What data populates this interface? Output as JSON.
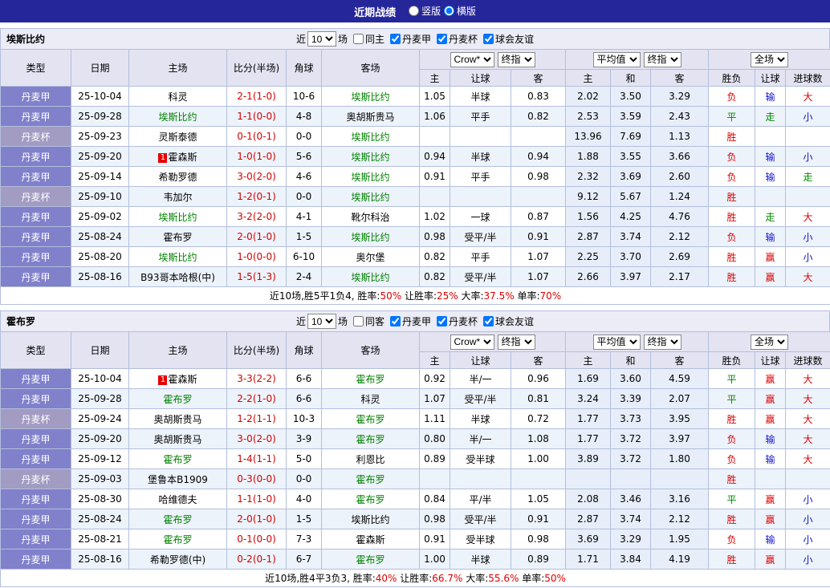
{
  "topbar": {
    "title": "近期战绩",
    "layout_options": [
      {
        "label": "竖版",
        "selected": false
      },
      {
        "label": "横版",
        "selected": true
      }
    ]
  },
  "palette": {
    "topbar_bg": "#26269b",
    "league_bg": "#8080cb",
    "cup_bg": "#a29bc2",
    "score": "#d40000",
    "team_green": "#008000",
    "red": "#dd0000",
    "green": "#008800",
    "blue": "#1111cc"
  },
  "table_head": {
    "cols": [
      "类型",
      "日期",
      "主场",
      "比分(半场)",
      "角球",
      "客场"
    ],
    "sub": [
      "主",
      "让球",
      "客",
      "主",
      "和",
      "客",
      "胜负",
      "让球",
      "进球数"
    ],
    "selects": {
      "company": "Crow*",
      "company_stage": "终指",
      "average": "平均值",
      "average_stage": "终指",
      "scope": "全场"
    }
  },
  "sections": [
    {
      "team": "埃斯比约",
      "filter": {
        "prefix": "近",
        "count": "10",
        "suffix": "场",
        "same": {
          "label": "同主",
          "checked": false
        },
        "comps": [
          {
            "label": "丹麦甲",
            "checked": true
          },
          {
            "label": "丹麦杯",
            "checked": true
          },
          {
            "label": "球会友谊",
            "checked": true
          }
        ]
      },
      "rows": [
        {
          "type": "丹麦甲",
          "cup": false,
          "date": "25-10-04",
          "home": {
            "name": "科灵",
            "green": false,
            "badge": ""
          },
          "score": "2-1(1-0)",
          "corner": "10-6",
          "away": {
            "name": "埃斯比约",
            "green": true,
            "badge": ""
          },
          "odds": [
            "1.05",
            "半球",
            "0.83"
          ],
          "avg": [
            "2.02",
            "3.50",
            "3.29"
          ],
          "res": [
            [
              "负",
              "red"
            ],
            [
              "输",
              "blue"
            ],
            [
              "大",
              "red"
            ]
          ]
        },
        {
          "type": "丹麦甲",
          "cup": false,
          "date": "25-09-28",
          "home": {
            "name": "埃斯比约",
            "green": true,
            "badge": ""
          },
          "score": "1-1(0-0)",
          "corner": "4-8",
          "away": {
            "name": "奥胡斯贵马",
            "green": false,
            "badge": ""
          },
          "odds": [
            "1.06",
            "平手",
            "0.82"
          ],
          "avg": [
            "2.53",
            "3.59",
            "2.43"
          ],
          "res": [
            [
              "平",
              "green"
            ],
            [
              "走",
              "green"
            ],
            [
              "小",
              "blue"
            ]
          ]
        },
        {
          "type": "丹麦杯",
          "cup": true,
          "date": "25-09-23",
          "home": {
            "name": "灵斯泰德",
            "green": false,
            "badge": ""
          },
          "score": "0-1(0-1)",
          "corner": "0-0",
          "away": {
            "name": "埃斯比约",
            "green": true,
            "badge": ""
          },
          "odds": [
            "",
            "",
            ""
          ],
          "avg": [
            "13.96",
            "7.69",
            "1.13"
          ],
          "res": [
            [
              "胜",
              "red"
            ],
            [
              "",
              ""
            ],
            [
              "",
              ""
            ]
          ]
        },
        {
          "type": "丹麦甲",
          "cup": false,
          "date": "25-09-20",
          "home": {
            "name": "霍森斯",
            "green": false,
            "badge": "1"
          },
          "score": "1-0(1-0)",
          "corner": "5-6",
          "away": {
            "name": "埃斯比约",
            "green": true,
            "badge": ""
          },
          "odds": [
            "0.94",
            "半球",
            "0.94"
          ],
          "avg": [
            "1.88",
            "3.55",
            "3.66"
          ],
          "res": [
            [
              "负",
              "red"
            ],
            [
              "输",
              "blue"
            ],
            [
              "小",
              "blue"
            ]
          ]
        },
        {
          "type": "丹麦甲",
          "cup": false,
          "date": "25-09-14",
          "home": {
            "name": "希勒罗德",
            "green": false,
            "badge": ""
          },
          "score": "3-0(2-0)",
          "corner": "4-6",
          "away": {
            "name": "埃斯比约",
            "green": true,
            "badge": ""
          },
          "odds": [
            "0.91",
            "平手",
            "0.98"
          ],
          "avg": [
            "2.32",
            "3.69",
            "2.60"
          ],
          "res": [
            [
              "负",
              "red"
            ],
            [
              "输",
              "blue"
            ],
            [
              "走",
              "green"
            ]
          ]
        },
        {
          "type": "丹麦杯",
          "cup": true,
          "date": "25-09-10",
          "home": {
            "name": "韦加尔",
            "green": false,
            "badge": ""
          },
          "score": "1-2(0-1)",
          "corner": "0-0",
          "away": {
            "name": "埃斯比约",
            "green": true,
            "badge": ""
          },
          "odds": [
            "",
            "",
            ""
          ],
          "avg": [
            "9.12",
            "5.67",
            "1.24"
          ],
          "res": [
            [
              "胜",
              "red"
            ],
            [
              "",
              ""
            ],
            [
              "",
              ""
            ]
          ]
        },
        {
          "type": "丹麦甲",
          "cup": false,
          "date": "25-09-02",
          "home": {
            "name": "埃斯比约",
            "green": true,
            "badge": ""
          },
          "score": "3-2(2-0)",
          "corner": "4-1",
          "away": {
            "name": "靴尔科治",
            "green": false,
            "badge": ""
          },
          "odds": [
            "1.02",
            "一球",
            "0.87"
          ],
          "avg": [
            "1.56",
            "4.25",
            "4.76"
          ],
          "res": [
            [
              "胜",
              "red"
            ],
            [
              "走",
              "green"
            ],
            [
              "大",
              "red"
            ]
          ]
        },
        {
          "type": "丹麦甲",
          "cup": false,
          "date": "25-08-24",
          "home": {
            "name": "霍布罗",
            "green": false,
            "badge": ""
          },
          "score": "2-0(1-0)",
          "corner": "1-5",
          "away": {
            "name": "埃斯比约",
            "green": true,
            "badge": ""
          },
          "odds": [
            "0.98",
            "受平/半",
            "0.91"
          ],
          "avg": [
            "2.87",
            "3.74",
            "2.12"
          ],
          "res": [
            [
              "负",
              "red"
            ],
            [
              "输",
              "blue"
            ],
            [
              "小",
              "blue"
            ]
          ]
        },
        {
          "type": "丹麦甲",
          "cup": false,
          "date": "25-08-20",
          "home": {
            "name": "埃斯比约",
            "green": true,
            "badge": ""
          },
          "score": "1-0(0-0)",
          "corner": "6-10",
          "away": {
            "name": "奥尔堡",
            "green": false,
            "badge": ""
          },
          "odds": [
            "0.82",
            "平手",
            "1.07"
          ],
          "avg": [
            "2.25",
            "3.70",
            "2.69"
          ],
          "res": [
            [
              "胜",
              "red"
            ],
            [
              "赢",
              "red"
            ],
            [
              "小",
              "blue"
            ]
          ]
        },
        {
          "type": "丹麦甲",
          "cup": false,
          "date": "25-08-16",
          "home": {
            "name": "B93哥本哈根(中)",
            "green": false,
            "badge": ""
          },
          "score": "1-5(1-3)",
          "corner": "2-4",
          "away": {
            "name": "埃斯比约",
            "green": true,
            "badge": ""
          },
          "odds": [
            "0.82",
            "受平/半",
            "1.07"
          ],
          "avg": [
            "2.66",
            "3.97",
            "2.17"
          ],
          "res": [
            [
              "胜",
              "red"
            ],
            [
              "赢",
              "red"
            ],
            [
              "大",
              "red"
            ]
          ]
        }
      ],
      "footer": [
        {
          "t": "近10场,胜5平1负4, 胜率:",
          "c": "black"
        },
        {
          "t": "50%",
          "c": "red"
        },
        {
          "t": " 让胜率:",
          "c": "black"
        },
        {
          "t": "25%",
          "c": "red"
        },
        {
          "t": " 大率:",
          "c": "black"
        },
        {
          "t": "37.5%",
          "c": "red"
        },
        {
          "t": " 单率:",
          "c": "black"
        },
        {
          "t": "70%",
          "c": "red"
        }
      ]
    },
    {
      "team": "霍布罗",
      "filter": {
        "prefix": "近",
        "count": "10",
        "suffix": "场",
        "same": {
          "label": "同客",
          "checked": false
        },
        "comps": [
          {
            "label": "丹麦甲",
            "checked": true
          },
          {
            "label": "丹麦杯",
            "checked": true
          },
          {
            "label": "球会友谊",
            "checked": true
          }
        ]
      },
      "rows": [
        {
          "type": "丹麦甲",
          "cup": false,
          "date": "25-10-04",
          "home": {
            "name": "霍森斯",
            "green": false,
            "badge": "1"
          },
          "score": "3-3(2-2)",
          "corner": "6-6",
          "away": {
            "name": "霍布罗",
            "green": true,
            "badge": ""
          },
          "odds": [
            "0.92",
            "半/一",
            "0.96"
          ],
          "avg": [
            "1.69",
            "3.60",
            "4.59"
          ],
          "res": [
            [
              "平",
              "green"
            ],
            [
              "赢",
              "red"
            ],
            [
              "大",
              "red"
            ]
          ]
        },
        {
          "type": "丹麦甲",
          "cup": false,
          "date": "25-09-28",
          "home": {
            "name": "霍布罗",
            "green": true,
            "badge": ""
          },
          "score": "2-2(1-0)",
          "corner": "6-6",
          "away": {
            "name": "科灵",
            "green": false,
            "badge": ""
          },
          "odds": [
            "1.07",
            "受平/半",
            "0.81"
          ],
          "avg": [
            "3.24",
            "3.39",
            "2.07"
          ],
          "res": [
            [
              "平",
              "green"
            ],
            [
              "赢",
              "red"
            ],
            [
              "大",
              "red"
            ]
          ]
        },
        {
          "type": "丹麦杯",
          "cup": true,
          "date": "25-09-24",
          "home": {
            "name": "奥胡斯贵马",
            "green": false,
            "badge": ""
          },
          "score": "1-2(1-1)",
          "corner": "10-3",
          "away": {
            "name": "霍布罗",
            "green": true,
            "badge": ""
          },
          "odds": [
            "1.11",
            "半球",
            "0.72"
          ],
          "avg": [
            "1.77",
            "3.73",
            "3.95"
          ],
          "res": [
            [
              "胜",
              "red"
            ],
            [
              "赢",
              "red"
            ],
            [
              "大",
              "red"
            ]
          ]
        },
        {
          "type": "丹麦甲",
          "cup": false,
          "date": "25-09-20",
          "home": {
            "name": "奥胡斯贵马",
            "green": false,
            "badge": ""
          },
          "score": "3-0(2-0)",
          "corner": "3-9",
          "away": {
            "name": "霍布罗",
            "green": true,
            "badge": ""
          },
          "odds": [
            "0.80",
            "半/一",
            "1.08"
          ],
          "avg": [
            "1.77",
            "3.72",
            "3.97"
          ],
          "res": [
            [
              "负",
              "red"
            ],
            [
              "输",
              "blue"
            ],
            [
              "大",
              "red"
            ]
          ]
        },
        {
          "type": "丹麦甲",
          "cup": false,
          "date": "25-09-12",
          "home": {
            "name": "霍布罗",
            "green": true,
            "badge": ""
          },
          "score": "1-4(1-1)",
          "corner": "5-0",
          "away": {
            "name": "利恩比",
            "green": false,
            "badge": ""
          },
          "odds": [
            "0.89",
            "受半球",
            "1.00"
          ],
          "avg": [
            "3.89",
            "3.72",
            "1.80"
          ],
          "res": [
            [
              "负",
              "red"
            ],
            [
              "输",
              "blue"
            ],
            [
              "大",
              "red"
            ]
          ]
        },
        {
          "type": "丹麦杯",
          "cup": true,
          "date": "25-09-03",
          "home": {
            "name": "堡鲁本B1909",
            "green": false,
            "badge": ""
          },
          "score": "0-3(0-0)",
          "corner": "0-0",
          "away": {
            "name": "霍布罗",
            "green": true,
            "badge": ""
          },
          "odds": [
            "",
            "",
            ""
          ],
          "avg": [
            "",
            "",
            ""
          ],
          "res": [
            [
              "胜",
              "red"
            ],
            [
              "",
              ""
            ],
            [
              "",
              ""
            ]
          ]
        },
        {
          "type": "丹麦甲",
          "cup": false,
          "date": "25-08-30",
          "home": {
            "name": "哈维德夫",
            "green": false,
            "badge": ""
          },
          "score": "1-1(1-0)",
          "corner": "4-0",
          "away": {
            "name": "霍布罗",
            "green": true,
            "badge": ""
          },
          "odds": [
            "0.84",
            "平/半",
            "1.05"
          ],
          "avg": [
            "2.08",
            "3.46",
            "3.16"
          ],
          "res": [
            [
              "平",
              "green"
            ],
            [
              "赢",
              "red"
            ],
            [
              "小",
              "blue"
            ]
          ]
        },
        {
          "type": "丹麦甲",
          "cup": false,
          "date": "25-08-24",
          "home": {
            "name": "霍布罗",
            "green": true,
            "badge": ""
          },
          "score": "2-0(1-0)",
          "corner": "1-5",
          "away": {
            "name": "埃斯比约",
            "green": false,
            "badge": ""
          },
          "odds": [
            "0.98",
            "受平/半",
            "0.91"
          ],
          "avg": [
            "2.87",
            "3.74",
            "2.12"
          ],
          "res": [
            [
              "胜",
              "red"
            ],
            [
              "赢",
              "red"
            ],
            [
              "小",
              "blue"
            ]
          ]
        },
        {
          "type": "丹麦甲",
          "cup": false,
          "date": "25-08-21",
          "home": {
            "name": "霍布罗",
            "green": true,
            "badge": ""
          },
          "score": "0-1(0-0)",
          "corner": "7-3",
          "away": {
            "name": "霍森斯",
            "green": false,
            "badge": ""
          },
          "odds": [
            "0.91",
            "受半球",
            "0.98"
          ],
          "avg": [
            "3.69",
            "3.29",
            "1.95"
          ],
          "res": [
            [
              "负",
              "red"
            ],
            [
              "输",
              "blue"
            ],
            [
              "小",
              "blue"
            ]
          ]
        },
        {
          "type": "丹麦甲",
          "cup": false,
          "date": "25-08-16",
          "home": {
            "name": "希勒罗德(中)",
            "green": false,
            "badge": ""
          },
          "score": "0-2(0-1)",
          "corner": "6-7",
          "away": {
            "name": "霍布罗",
            "green": true,
            "badge": ""
          },
          "odds": [
            "1.00",
            "半球",
            "0.89"
          ],
          "avg": [
            "1.71",
            "3.84",
            "4.19"
          ],
          "res": [
            [
              "胜",
              "red"
            ],
            [
              "赢",
              "red"
            ],
            [
              "小",
              "blue"
            ]
          ]
        }
      ],
      "footer": [
        {
          "t": "近10场,胜4平3负3, 胜率:",
          "c": "black"
        },
        {
          "t": "40%",
          "c": "red"
        },
        {
          "t": " 让胜率:",
          "c": "black"
        },
        {
          "t": "66.7%",
          "c": "red"
        },
        {
          "t": " 大率:",
          "c": "black"
        },
        {
          "t": "55.6%",
          "c": "red"
        },
        {
          "t": " 单率:",
          "c": "black"
        },
        {
          "t": "50%",
          "c": "red"
        }
      ]
    }
  ]
}
